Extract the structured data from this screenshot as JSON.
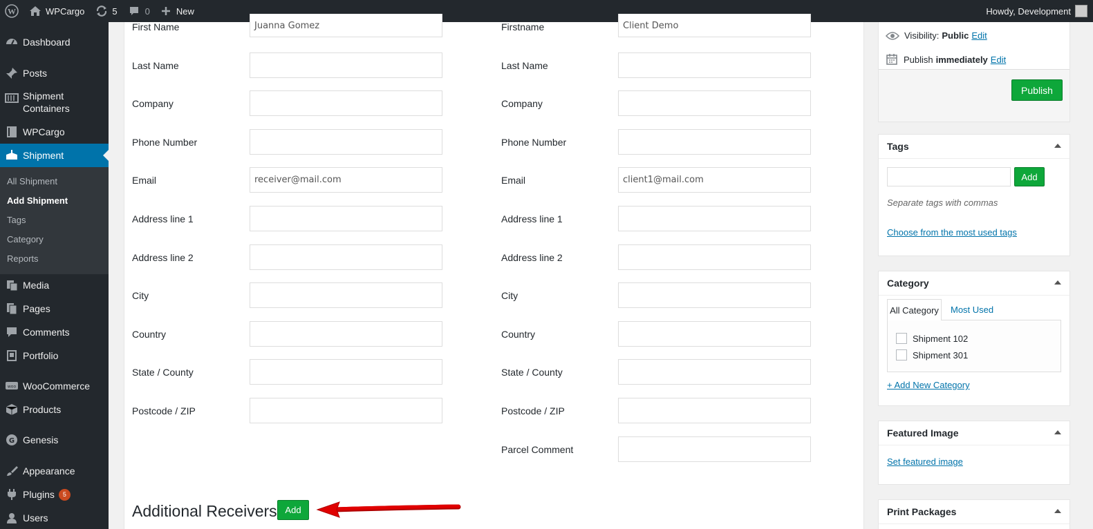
{
  "admin_bar": {
    "site_name": "WPCargo",
    "updates_count": "5",
    "comments_count": "0",
    "new_label": "New",
    "howdy": "Howdy, Development"
  },
  "sidebar": {
    "dashboard": "Dashboard",
    "posts": "Posts",
    "shipment_containers_1": "Shipment",
    "shipment_containers_2": "Containers",
    "wpcargo": "WPCargo",
    "shipment": "Shipment",
    "sub": {
      "all_shipment": "All Shipment",
      "add_shipment": "Add Shipment",
      "tags": "Tags",
      "category": "Category",
      "reports": "Reports"
    },
    "media": "Media",
    "pages": "Pages",
    "comments": "Comments",
    "portfolio": "Portfolio",
    "woocommerce": "WooCommerce",
    "products": "Products",
    "genesis": "Genesis",
    "appearance": "Appearance",
    "plugins": "Plugins",
    "plugins_badge": "5",
    "users": "Users"
  },
  "receiver": {
    "labels": [
      "First Name",
      "Last Name",
      "Company",
      "Phone Number",
      "Email",
      "Address line 1",
      "Address line 2",
      "City",
      "Country",
      "State / County",
      "Postcode / ZIP"
    ],
    "values": [
      "Juanna Gomez",
      "",
      "",
      "",
      "receiver@mail.com",
      "",
      "",
      "",
      "",
      "",
      ""
    ]
  },
  "client": {
    "labels": [
      "Firstname",
      "Last Name",
      "Company",
      "Phone Number",
      "Email",
      "Address line 1",
      "Address line 2",
      "City",
      "Country",
      "State / County",
      "Postcode / ZIP",
      "Parcel Comment"
    ],
    "values": [
      "Client Demo",
      "",
      "",
      "",
      "client1@mail.com",
      "",
      "",
      "",
      "",
      "",
      "",
      ""
    ]
  },
  "additional_receivers": {
    "title": "Additional Receivers",
    "add_label": "Add"
  },
  "publish_box": {
    "visibility_label": "Visibility:",
    "visibility_value": "Public",
    "visibility_edit": "Edit",
    "publish_label": "Publish",
    "publish_value": "immediately",
    "publish_edit": "Edit",
    "publish_button": "Publish"
  },
  "tags_box": {
    "title": "Tags",
    "add_label": "Add",
    "hint": "Separate tags with commas",
    "choose_link": "Choose from the most used tags"
  },
  "category_box": {
    "title": "Category",
    "tab_all": "All Category",
    "tab_most_used": "Most Used",
    "items": [
      "Shipment 102",
      "Shipment 301"
    ],
    "add_new": "+ Add New Category"
  },
  "featured_box": {
    "title": "Featured Image",
    "set_link": "Set featured image"
  },
  "print_box": {
    "title": "Print Packages"
  },
  "colors": {
    "accent": "#0073aa",
    "green": "#0ea73a",
    "arrow": "#e00000"
  }
}
